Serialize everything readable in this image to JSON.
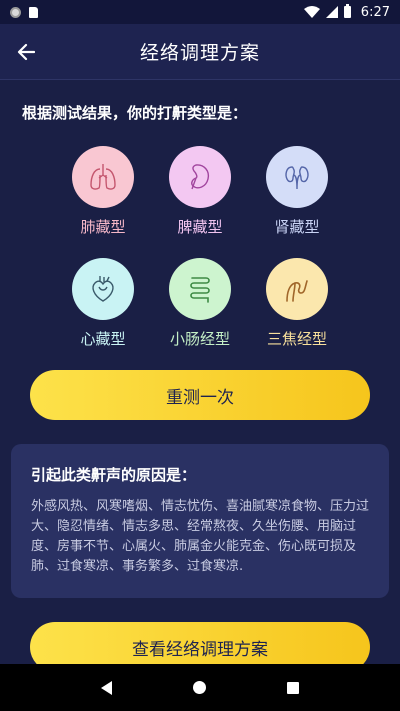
{
  "status_bar": {
    "time": "6:27"
  },
  "app_bar": {
    "title": "经络调理方案"
  },
  "result": {
    "title": "根据测试结果，你的打鼾类型是："
  },
  "types": [
    {
      "label": "肺藏型",
      "icon": "lungs-icon",
      "circle_color": "#f9c7d2",
      "label_color": "#f5b7c8"
    },
    {
      "label": "脾藏型",
      "icon": "spleen-icon",
      "circle_color": "#f3c8f2",
      "label_color": "#f0c3ef"
    },
    {
      "label": "肾藏型",
      "icon": "kidney-icon",
      "circle_color": "#d4ddf8",
      "label_color": "#c9d3f5"
    },
    {
      "label": "心藏型",
      "icon": "heart-organ-icon",
      "circle_color": "#c9f3f4",
      "label_color": "#c9f3f4"
    },
    {
      "label": "小肠经型",
      "icon": "intestine-icon",
      "circle_color": "#cdf4cf",
      "label_color": "#c4efc6"
    },
    {
      "label": "三焦经型",
      "icon": "sanjiao-icon",
      "circle_color": "#fbe7ad",
      "label_color": "#f7df9c"
    }
  ],
  "buttons": {
    "retest": "重测一次",
    "view_plan": "查看经络调理方案"
  },
  "cause": {
    "title": "引起此类鼾声的原因是：",
    "text": "外感风热、风寒嗜烟、情志忧伤、喜油腻寒凉食物、压力过大、隐忍情绪、情志多思、经常熬夜、久坐伤腰、用脑过度、房事不节、心属火、肺属金火能克金、伤心既可损及肺、过食寒凉、事务繁多、过食寒凉."
  }
}
